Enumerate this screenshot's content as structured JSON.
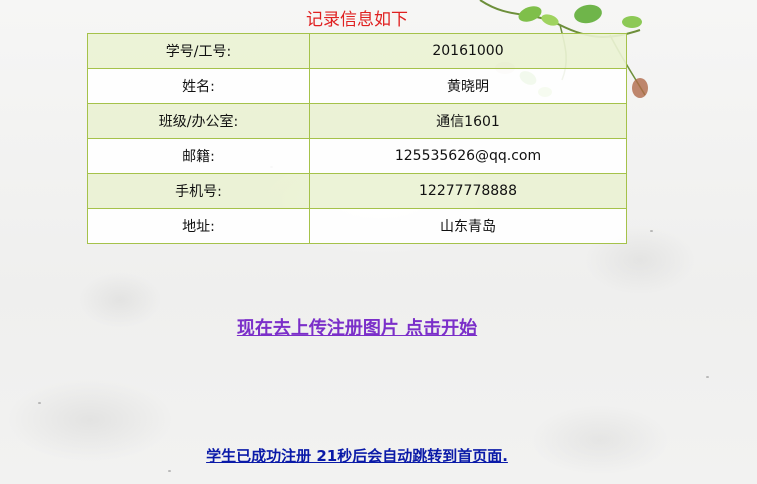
{
  "page": {
    "title": "记录信息如下"
  },
  "records": [
    {
      "label": "学号/工号:",
      "value": "20161000"
    },
    {
      "label": "姓名:",
      "value": "黄晓明"
    },
    {
      "label": "班级/办公室:",
      "value": "通信1601"
    },
    {
      "label": "邮籍:",
      "value": "125535626@qq.com"
    },
    {
      "label": "手机号:",
      "value": "12277778888"
    },
    {
      "label": "地址:",
      "value": "山东青岛"
    }
  ],
  "upload_link": {
    "text": "现在去上传注册图片  点击开始"
  },
  "redirect": {
    "text": "学生已成功注册  21秒后会自动跳转到首页面."
  },
  "colors": {
    "title": "#e02020",
    "table_border": "#a5c24a",
    "row_highlight": "#eaf2d4",
    "link": "#7b2fc9",
    "redirect_text": "#0a1aa8"
  }
}
